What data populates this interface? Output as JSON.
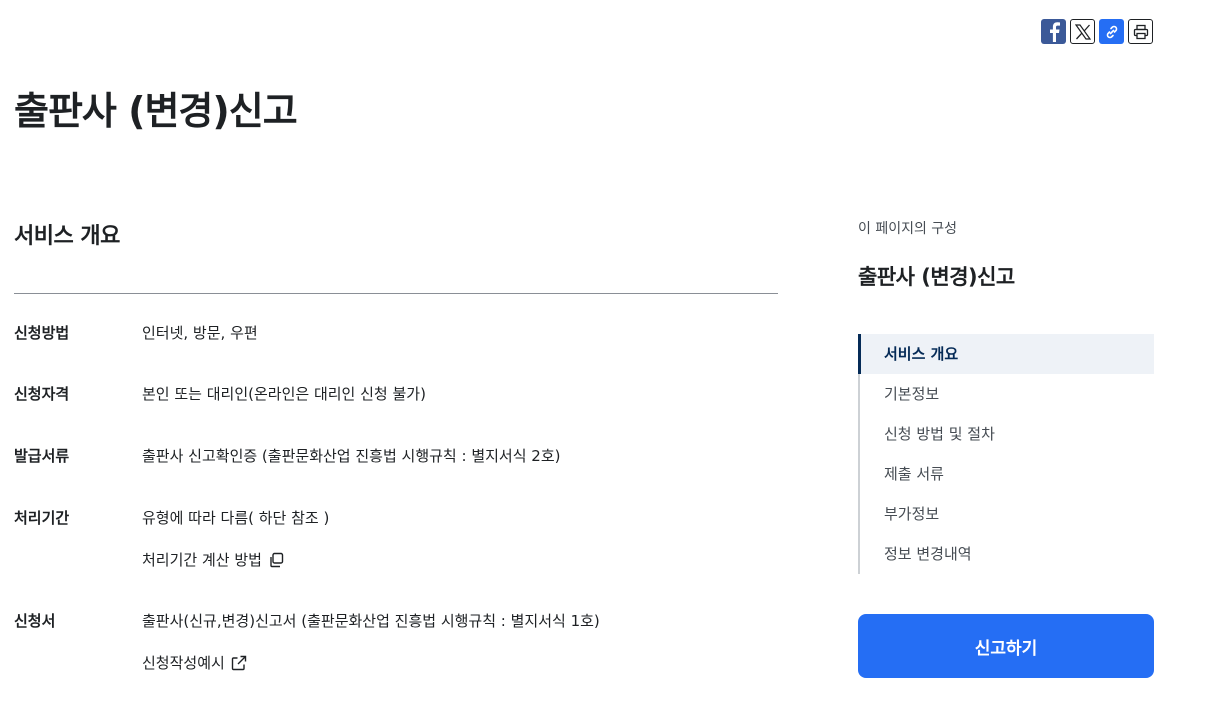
{
  "share": {
    "facebook": "facebook-icon",
    "x": "x-icon",
    "link": "link-icon",
    "print": "print-icon"
  },
  "page": {
    "title": "출판사 (변경)신고"
  },
  "overview": {
    "title": "서비스 개요",
    "rows": [
      {
        "label": "신청방법",
        "value": "인터넷, 방문, 우편"
      },
      {
        "label": "신청자격",
        "value": "본인 또는 대리인(온라인은 대리인 신청 불가)"
      },
      {
        "label": "발급서류",
        "value": "출판사 신고확인증 (출판문화산업 진흥법 시행규칙 : 별지서식 2호)"
      },
      {
        "label": "처리기간",
        "value": "유형에 따라 다름( 하단 참조 )",
        "sub": "처리기간 계산 방법"
      },
      {
        "label": "신청서",
        "value": "출판사(신규,변경)신고서 (출판문화산업 진흥법 시행규칙 : 별지서식 1호)",
        "sub": "신청작성예시"
      }
    ]
  },
  "toc": {
    "caption": "이 페이지의 구성",
    "title": "출판사 (변경)신고",
    "items": [
      {
        "label": "서비스 개요"
      },
      {
        "label": "기본정보"
      },
      {
        "label": "신청 방법 및 절차"
      },
      {
        "label": "제출 서류"
      },
      {
        "label": "부가정보"
      },
      {
        "label": "정보 변경내역"
      }
    ]
  },
  "apply_button": "신고하기",
  "colors": {
    "accent": "#256ef4",
    "active_nav": "#052b57",
    "facebook": "#3b5998"
  }
}
